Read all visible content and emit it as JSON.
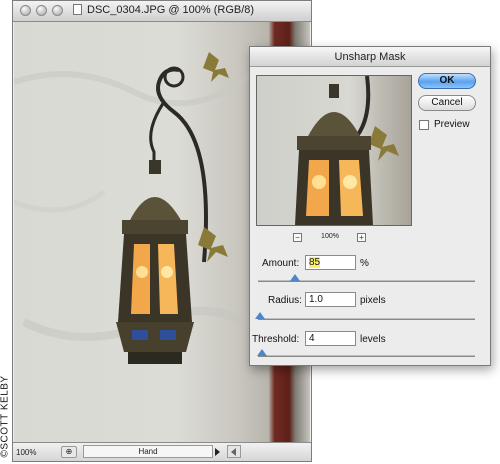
{
  "document": {
    "title": "DSC_0304.JPG @ 100% (RGB/8)",
    "status_zoom": "100%",
    "status_tool": "Hand"
  },
  "credit": "©SCOTT KELBY",
  "dialog": {
    "title": "Unsharp Mask",
    "preview_zoom": "100%",
    "ok_label": "OK",
    "cancel_label": "Cancel",
    "preview_label": "Preview",
    "preview_checked": false,
    "amount": {
      "label": "Amount:",
      "value": "85",
      "unit": "%",
      "slider_fraction": 0.17
    },
    "radius": {
      "label": "Radius:",
      "value": "1.0",
      "unit": "pixels",
      "slider_fraction": 0.01
    },
    "threshold": {
      "label": "Threshold:",
      "value": "4",
      "unit": "levels",
      "slider_fraction": 0.02
    }
  },
  "colors": {
    "accent": "#5aa2ef",
    "highlight": "#fff06a",
    "wall": "#dcdcd6",
    "door": "#6f2a22"
  },
  "icons": [
    "close-light-icon",
    "minimize-light-icon",
    "zoom-light-icon",
    "file-icon",
    "zoom-out-icon",
    "zoom-in-icon",
    "lantern-photo"
  ]
}
